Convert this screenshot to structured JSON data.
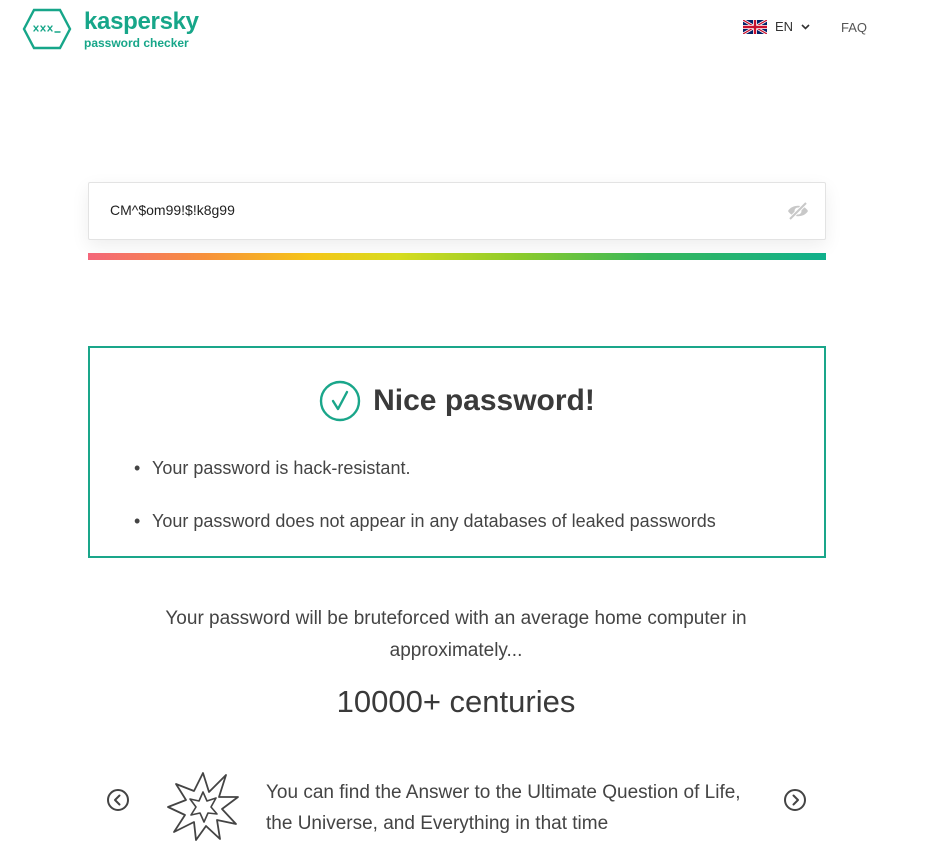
{
  "header": {
    "brand": "kaspersky",
    "product": "password checker",
    "language": "EN",
    "faq_label": "FAQ"
  },
  "password": {
    "value": "CM^$om99!$!k8g99",
    "strength_percent": 100
  },
  "result": {
    "title": "Nice password!",
    "bullets": [
      "Your password is hack-resistant.",
      "Your password does not appear in any databases of leaked passwords"
    ]
  },
  "bruteforce": {
    "text": "Your password will be bruteforced with an average home computer in approximately...",
    "time": "10000+ centuries"
  },
  "fact": {
    "text": "You can find the Answer to the Ultimate Question of Life, the Universe, and Everything in that time"
  },
  "colors": {
    "accent": "#1aa68a",
    "text": "#444444"
  },
  "icons": {
    "logo": "kaspersky-hexagon-logo-icon",
    "flag": "uk-flag-icon",
    "language_dropdown": "chevron-down-icon",
    "visibility_toggle": "eye-slash-icon",
    "result": "check-circle-icon",
    "previous": "chevron-left-circle-icon",
    "next": "chevron-right-circle-icon",
    "fact_illustration": "explosion-burst-icon"
  }
}
